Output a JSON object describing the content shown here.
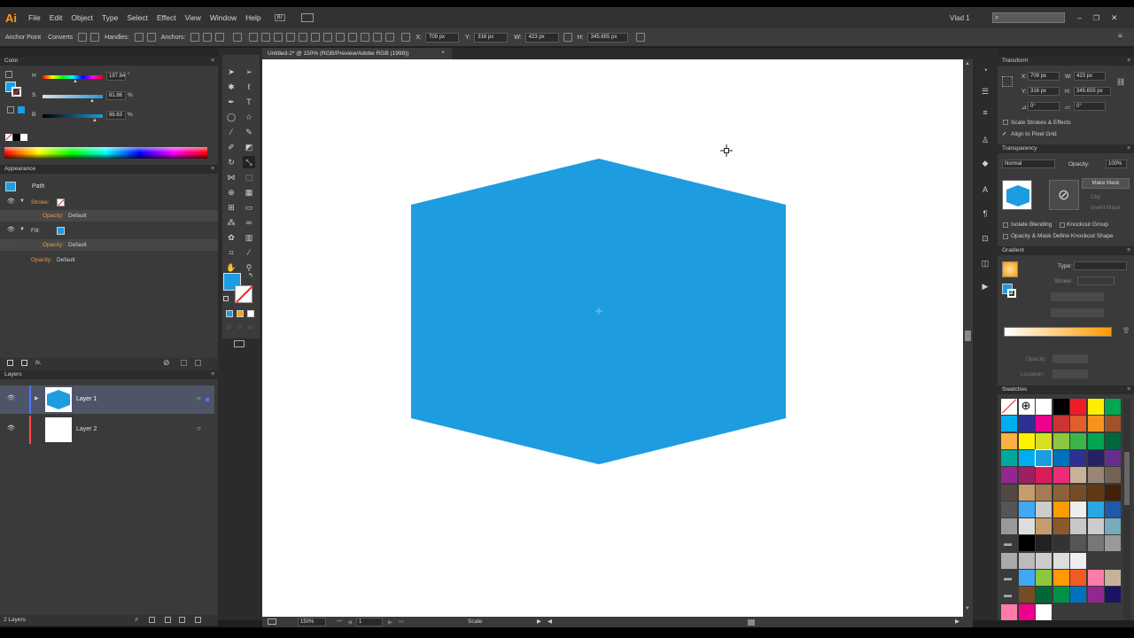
{
  "app": {
    "logo": "Ai",
    "user": "Vlad 1"
  },
  "menus": [
    "File",
    "Edit",
    "Object",
    "Type",
    "Select",
    "Effect",
    "View",
    "Window",
    "Help"
  ],
  "bridge_label": "Br",
  "control": {
    "mode": "Anchor Point",
    "converts": "Converts",
    "handles": "Handles:",
    "anchors": "Anchors:",
    "x_label": "X:",
    "x": "709 px",
    "y_label": "Y:",
    "y": "316 px",
    "w_label": "W:",
    "w": "423 px",
    "h_label": "H:",
    "h": "345.655 px"
  },
  "document_tab": {
    "title": "Untitled-2* @ 150% (RGB/Preview/Adobe RGB (1998))",
    "close": "×"
  },
  "color_panel": {
    "title": "Color",
    "h_label": "H",
    "h": "197.84",
    "h_unit": "°",
    "s_label": "S",
    "s": "81.86",
    "s_unit": "%",
    "b_label": "B",
    "b": "86.63",
    "b_unit": "%"
  },
  "appearance_panel": {
    "title": "Appearance",
    "path_label": "Path",
    "stroke_label": "Stroke:",
    "opacity_label": "Opacity:",
    "opacity_value": "Default",
    "fill_label": "Fill:",
    "fx_label": "fx."
  },
  "layers_panel": {
    "title": "Layers",
    "layers": [
      {
        "name": "Layer 1"
      },
      {
        "name": "Layer 2"
      }
    ],
    "count": "2 Layers"
  },
  "transform_panel": {
    "title": "Transform",
    "x_label": "X:",
    "x": "709 px",
    "y_label": "Y:",
    "y": "316 px",
    "w_label": "W:",
    "w": "423 px",
    "h_label": "H:",
    "h": "345.655 px",
    "angle1": "0°",
    "angle2": "0°",
    "scale_strokes": "Scale Strokes & Effects",
    "align_pixel": "Align to Pixel Grid"
  },
  "transparency_panel": {
    "title": "Transparency",
    "blend": "Normal",
    "opacity_label": "Opacity:",
    "opacity": "100%",
    "make_mask": "Make Mask",
    "clip": "Clip",
    "invert": "Invert Mask",
    "isolate": "Isolate Blending",
    "knockout": "Knockout Group",
    "define": "Opacity & Mask Define Knockout Shape"
  },
  "gradient_panel": {
    "title": "Gradient",
    "type_label": "Type:",
    "stroke_label": "Stroke:",
    "opacity_label": "Opacity:",
    "location_label": "Location:"
  },
  "swatches_panel": {
    "title": "Swatches"
  },
  "status": {
    "zoom": "150%",
    "page": "1",
    "tool": "Scale"
  },
  "colors": {
    "fill": "#1e9ce0",
    "accent_orange": "#ff9a00"
  }
}
